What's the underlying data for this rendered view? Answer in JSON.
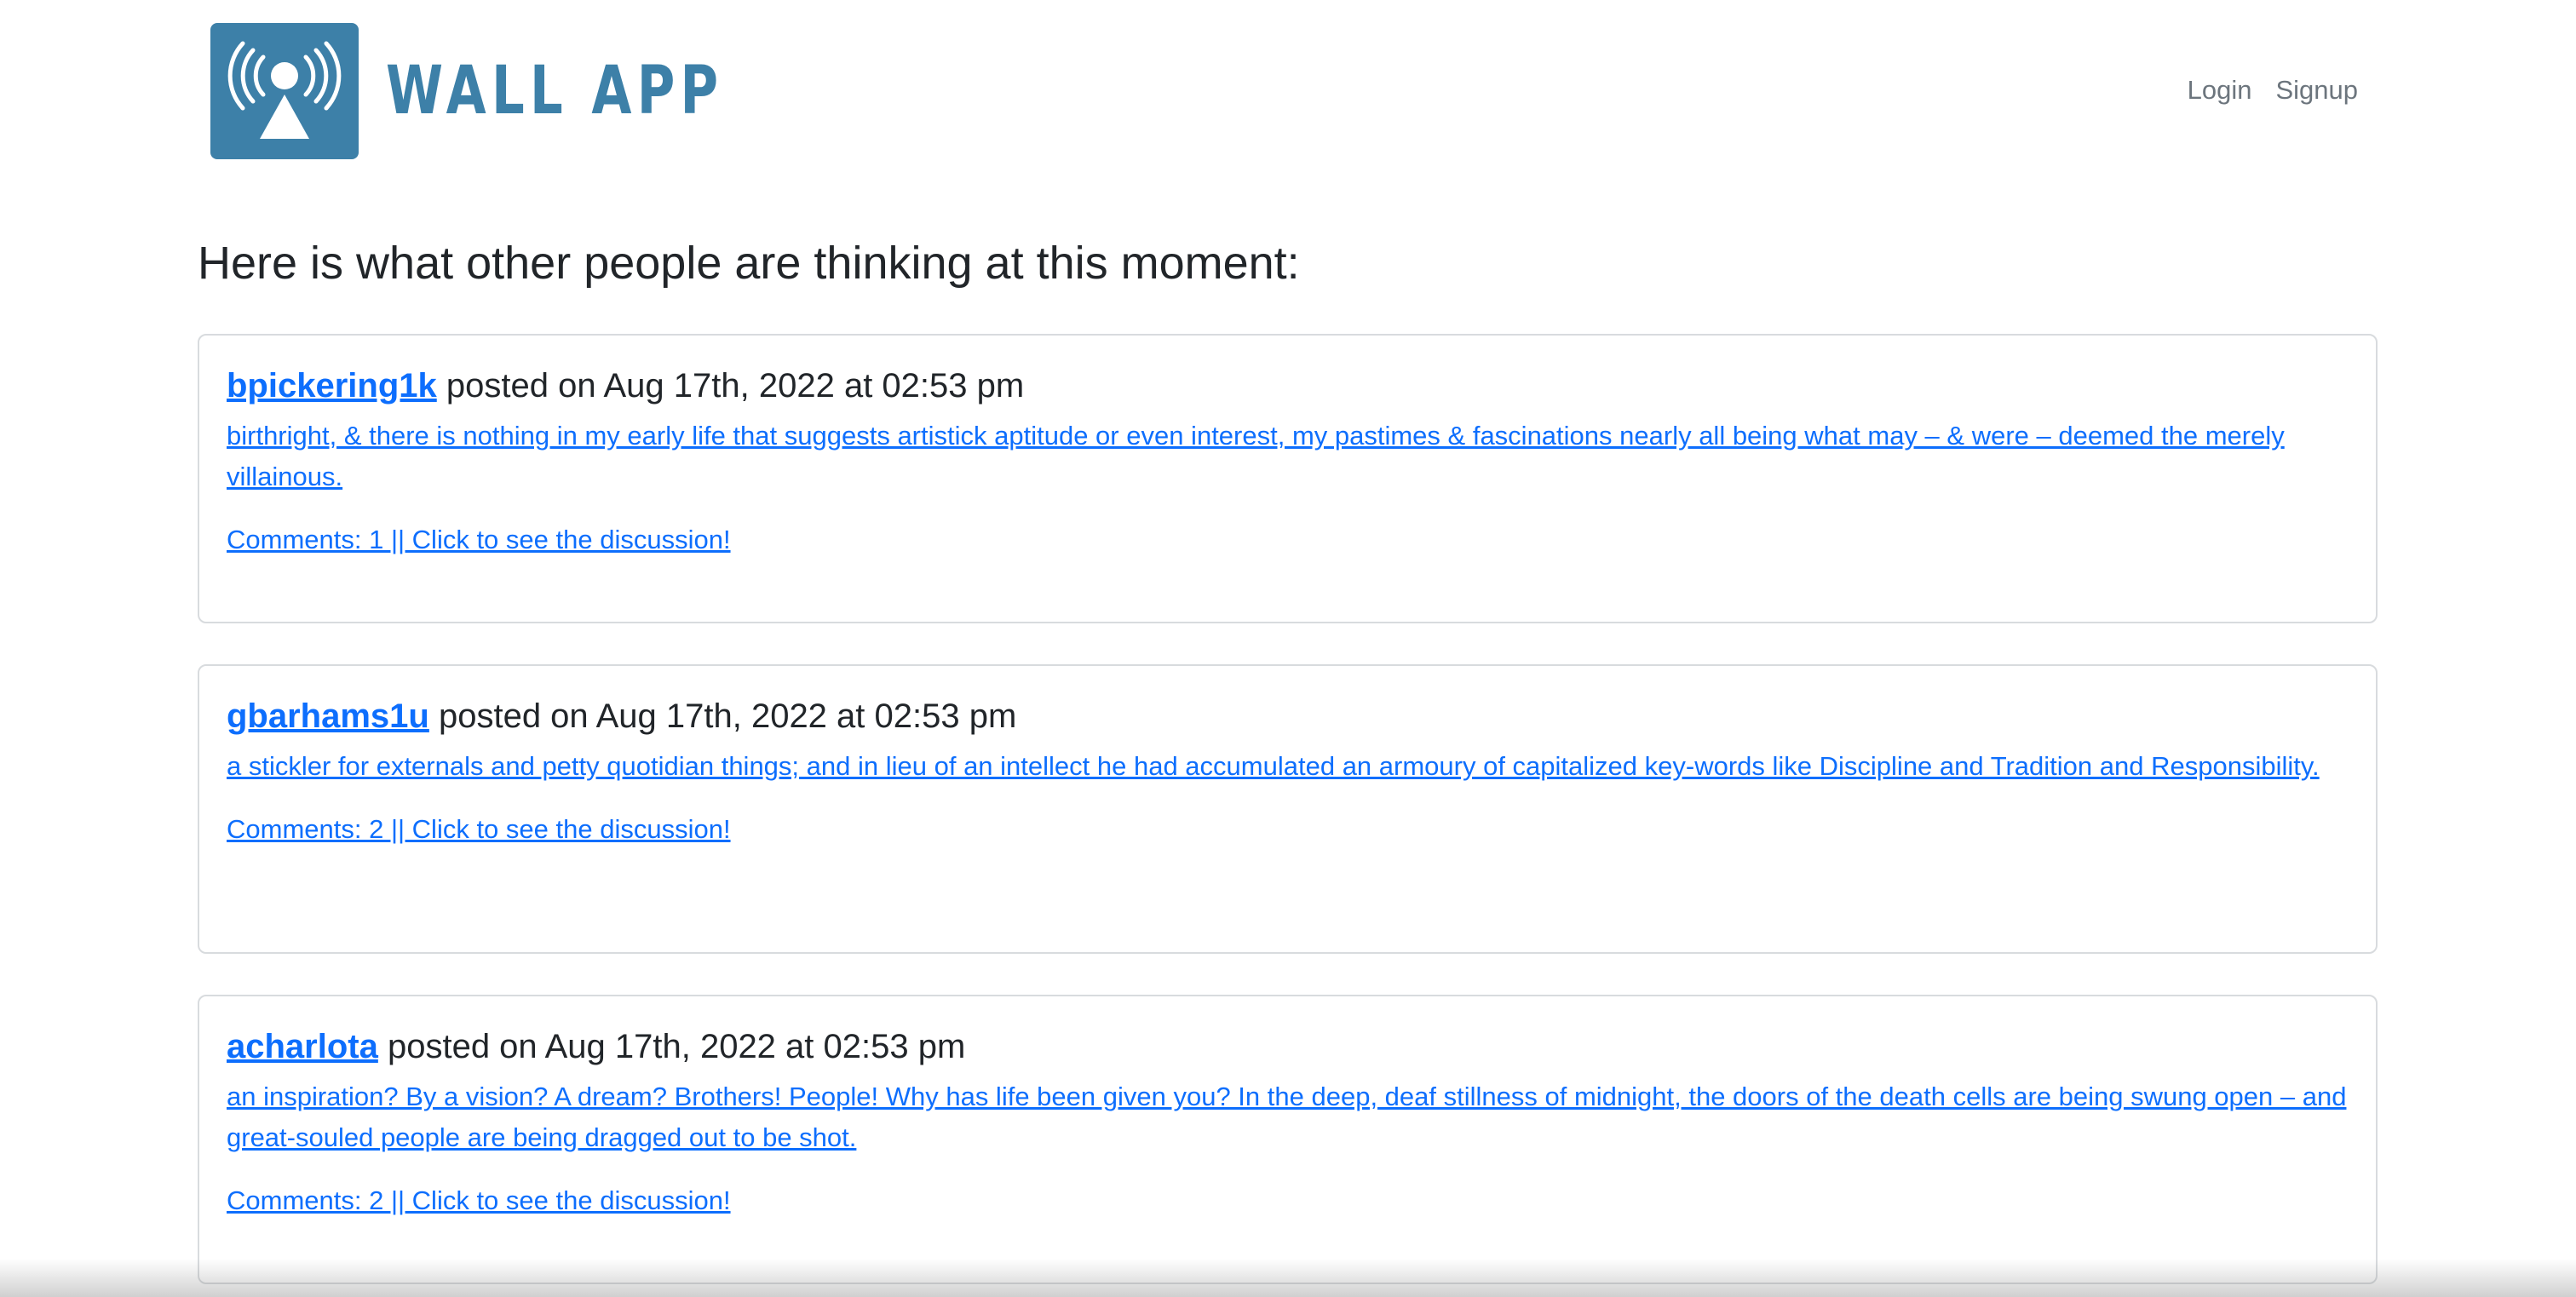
{
  "navbar": {
    "brand_name": "WALL APP",
    "logo_icon": "broadcast-tower-icon",
    "brand_color": "#3d80a8",
    "links": [
      "Login",
      "Signup"
    ]
  },
  "main": {
    "heading": "Here is what other people are thinking at this moment:",
    "posts": [
      {
        "author": "bpickering1k",
        "meta": " posted on Aug 17th, 2022 at 02:53 pm",
        "body": "birthright, & there is nothing in my early life that suggests artistick aptitude or even interest, my pastimes & fascinations nearly all being what may – & were – deemed the merely villainous.",
        "comments": "Comments: 1 || Click to see the discussion!"
      },
      {
        "author": "gbarhams1u",
        "meta": " posted on Aug 17th, 2022 at 02:53 pm",
        "body": "a stickler for externals and petty quotidian things; and in lieu of an intellect he had accumulated an armoury of capitalized key-words like Discipline and Tradition and Responsibility.",
        "comments": "Comments: 2 || Click to see the discussion!"
      },
      {
        "author": "acharlota",
        "meta": " posted on Aug 17th, 2022 at 02:53 pm",
        "body": "an inspiration? By a vision? A dream? Brothers! People! Why has life been given you? In the deep, deaf stillness of midnight, the doors of the death cells are being swung open – and great-souled people are being dragged out to be shot.",
        "comments": "Comments: 2 || Click to see the discussion!"
      }
    ]
  },
  "colors": {
    "link": "#0d6efd",
    "nav_link": "#6c757d",
    "card_border": "#d8dbde"
  }
}
